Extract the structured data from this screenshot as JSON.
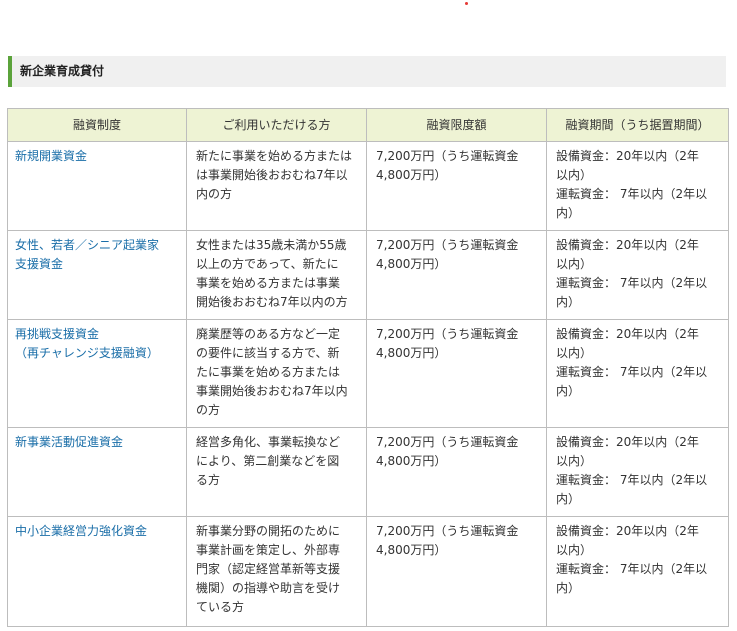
{
  "section": {
    "title": "新企業育成貸付"
  },
  "table": {
    "headers": [
      "融資制度",
      "ご利用いただける方",
      "融資限度額",
      "融資期間（うち据置期間）"
    ],
    "rows": [
      {
        "name": [
          "新規開業資金"
        ],
        "eligible": [
          "新たに事業を始める方または",
          "は事業開始後おおむね7年以",
          "内の方"
        ],
        "limit": [
          "7,200万円（うち運転資金",
          "4,800万円）"
        ],
        "term": [
          "設備資金：20年以内（2年",
          "以内）",
          "運転資金： 7年以内（2年以",
          "内）"
        ]
      },
      {
        "name": [
          "女性、若者／シニア起業家",
          "支援資金"
        ],
        "eligible": [
          "女性または35歳未満か55歳",
          "以上の方であって、新たに",
          "事業を始める方または事業",
          "開始後おおむね7年以内の方"
        ],
        "limit": [
          "7,200万円（うち運転資金",
          "4,800万円）"
        ],
        "term": [
          "設備資金：20年以内（2年",
          "以内）",
          "運転資金： 7年以内（2年以",
          "内）"
        ]
      },
      {
        "name": [
          "再挑戦支援資金",
          "（再チャレンジ支援融資）"
        ],
        "eligible": [
          "廃業歴等のある方など一定",
          "の要件に該当する方で、新",
          "たに事業を始める方または",
          "事業開始後おおむね7年以内",
          "の方"
        ],
        "limit": [
          "7,200万円（うち運転資金",
          "4,800万円）"
        ],
        "term": [
          "設備資金：20年以内（2年",
          "以内）",
          "運転資金： 7年以内（2年以",
          "内）"
        ]
      },
      {
        "name": [
          "新事業活動促進資金"
        ],
        "eligible": [
          "経営多角化、事業転換など",
          "により、第二創業などを図",
          "る方"
        ],
        "limit": [
          "7,200万円（うち運転資金",
          "4,800万円）"
        ],
        "term": [
          "設備資金：20年以内（2年",
          "以内）",
          "運転資金： 7年以内（2年以",
          "内）"
        ]
      },
      {
        "name": [
          "中小企業経営力強化資金"
        ],
        "eligible": [
          "新事業分野の開拓のために",
          "事業計画を策定し、外部専",
          "門家（認定経営革新等支援",
          "機関）の指導や助言を受け",
          "ている方"
        ],
        "limit": [
          "7,200万円（うち運転資金",
          "4,800万円）"
        ],
        "term": [
          "設備資金：20年以内（2年",
          "以内）",
          "運転資金： 7年以内（2年以",
          "内）"
        ]
      }
    ]
  }
}
